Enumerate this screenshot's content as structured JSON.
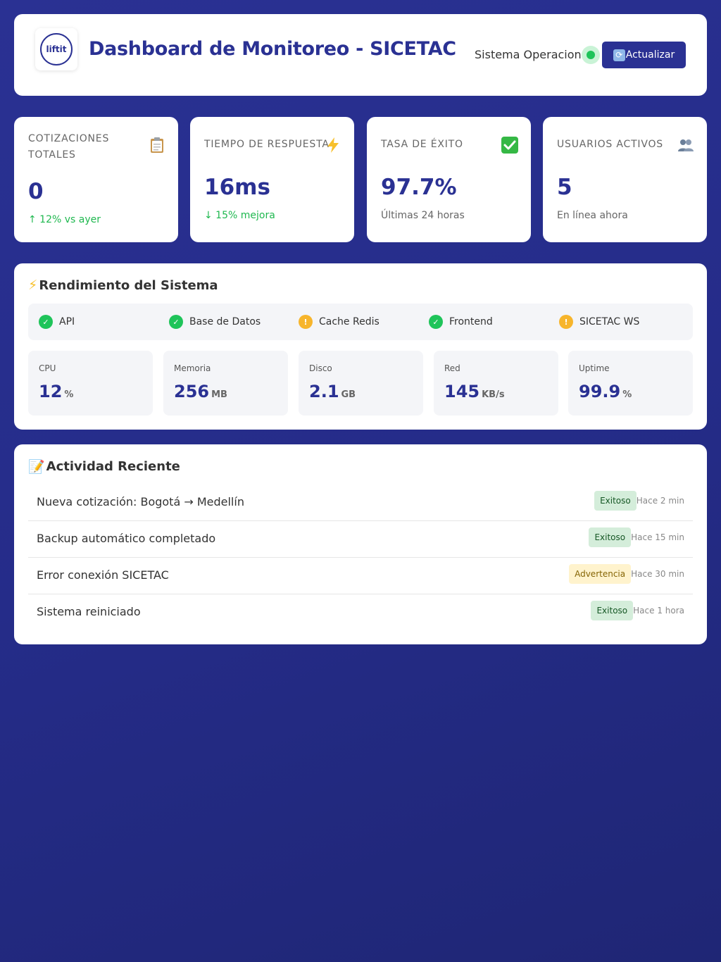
{
  "header": {
    "logo_text": "liftit",
    "title": "Dashboard de Monitoreo - SICETAC",
    "status_text": "Sistema Operacional",
    "refresh_label": "Actualizar",
    "status_color": "#1fc45a",
    "accent_color": "#2a3193"
  },
  "stats": [
    {
      "label": "Cotizaciones Totales",
      "icon": "clipboard-icon",
      "value": "0",
      "sub": "↑ 12% vs ayer"
    },
    {
      "label": "Tiempo de Respuesta",
      "icon": "lightning-icon",
      "value": "16ms",
      "sub": "↓ 15% mejora"
    },
    {
      "label": "Tasa de Éxito",
      "icon": "check-mark-icon",
      "value": "97.7%",
      "sub": "Últimas 24 horas"
    },
    {
      "label": "Usuarios Activos",
      "icon": "users-icon",
      "value": "5",
      "sub": "En línea ahora"
    }
  ],
  "performance": {
    "title": "Rendimiento del Sistema",
    "services": [
      {
        "name": "API",
        "status": "ok"
      },
      {
        "name": "Base de Datos",
        "status": "ok"
      },
      {
        "name": "Cache Redis",
        "status": "warning"
      },
      {
        "name": "Frontend",
        "status": "ok"
      },
      {
        "name": "SICETAC WS",
        "status": "warning"
      }
    ],
    "metrics": [
      {
        "label": "CPU",
        "value": "12",
        "unit": "%"
      },
      {
        "label": "Memoria",
        "value": "256",
        "unit": "MB"
      },
      {
        "label": "Disco",
        "value": "2.1",
        "unit": "GB"
      },
      {
        "label": "Red",
        "value": "145",
        "unit": "KB/s"
      },
      {
        "label": "Uptime",
        "value": "99.9",
        "unit": "%"
      }
    ]
  },
  "activity": {
    "title": "Actividad Reciente",
    "items": [
      {
        "text": "Nueva cotización: Bogotá → Medellín",
        "badge": "Exitoso",
        "time": "Hace 2 min"
      },
      {
        "text": "Backup automático completado",
        "badge": "Exitoso",
        "time": "Hace 15 min"
      },
      {
        "text": "Error conexión SICETAC",
        "badge": "Advertencia",
        "time": "Hace 30 min"
      },
      {
        "text": "Sistema reiniciado",
        "badge": "Exitoso",
        "time": "Hace 1 hora"
      }
    ]
  }
}
